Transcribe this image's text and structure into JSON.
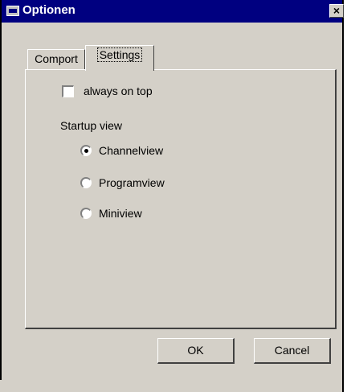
{
  "window": {
    "title": "Optionen",
    "close_glyph": "×",
    "icon": "app-window-icon"
  },
  "tabs": [
    {
      "label": "Comport",
      "active": false
    },
    {
      "label": "Settings",
      "active": true
    }
  ],
  "settings": {
    "always_on_top": {
      "label": "always on top",
      "checked": false
    },
    "startup_view_label": "Startup view",
    "startup_options": [
      {
        "label": "Channelview",
        "selected": true
      },
      {
        "label": "Programview",
        "selected": false
      },
      {
        "label": "Miniview",
        "selected": false
      }
    ]
  },
  "buttons": {
    "ok_label": "OK",
    "cancel_label": "Cancel"
  },
  "colors": {
    "titlebar": "#000080",
    "face": "#d4d0c8",
    "highlight": "#ffffff",
    "shadow": "#404040"
  }
}
